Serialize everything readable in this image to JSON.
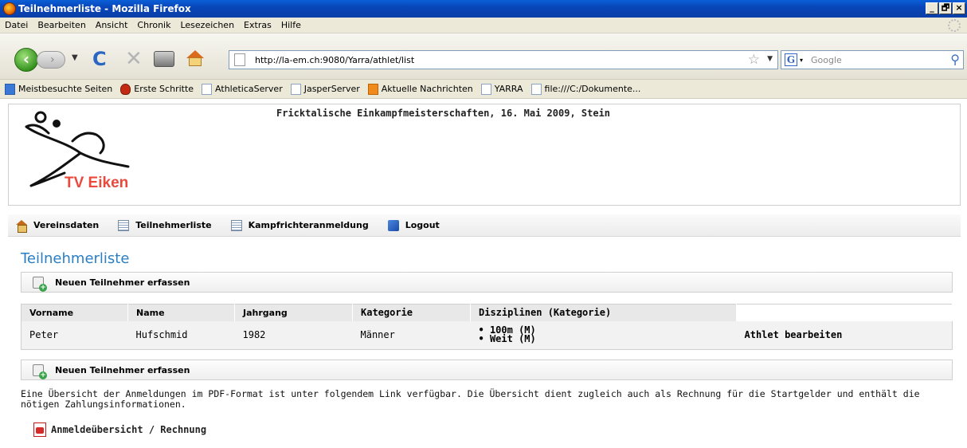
{
  "window": {
    "title": "Teilnehmerliste - Mozilla Firefox",
    "buttons": [
      "_",
      "🗗",
      "×"
    ]
  },
  "menu": {
    "items": [
      "Datei",
      "Bearbeiten",
      "Ansicht",
      "Chronik",
      "Lesezeichen",
      "Extras",
      "Hilfe"
    ]
  },
  "toolbar": {
    "url": "http://la-em.ch:9080/Yarra/athlet/list",
    "search_placeholder": "Google",
    "search_engine_icon": "G"
  },
  "bookmarks": {
    "items": [
      "Meistbesuchte Seiten",
      "Erste Schritte",
      "AthleticaServer",
      "JasperServer",
      "Aktuelle Nachrichten",
      "YARRA",
      "file:///C:/Dokumente..."
    ]
  },
  "header": {
    "logo_text": "TV Eiken",
    "event_title": "Fricktalische Einkampfmeisterschaften, 16. Mai 2009, Stein"
  },
  "app_nav": {
    "items": [
      {
        "label": "Vereinsdaten",
        "icon": "house-icon"
      },
      {
        "label": "Teilnehmerliste",
        "icon": "list-icon"
      },
      {
        "label": "Kampfrichteranmeldung",
        "icon": "list-icon"
      },
      {
        "label": "Logout",
        "icon": "logout-icon"
      }
    ]
  },
  "main": {
    "heading": "Teilnehmerliste",
    "add_label": "Neuen Teilnehmer erfassen",
    "table": {
      "columns": [
        "Vorname",
        "Name",
        "Jahrgang",
        "Kategorie",
        "Disziplinen (Kategorie)",
        ""
      ],
      "rows": [
        {
          "vorname": "Peter",
          "name": "Hufschmid",
          "jahrgang": "1982",
          "kategorie": "Männer",
          "disziplinen": [
            "• 100m (M)",
            "• Weit (M)"
          ],
          "action": "Athlet bearbeiten"
        }
      ]
    },
    "info_text": "Eine Übersicht der Anmeldungen im PDF-Format ist unter folgendem Link verfügbar. Die Übersicht dient zugleich auch als Rechnung für die Startgelder und enthält die nötigen Zahlungsinformationen.",
    "pdf_link": "Anmeldeübersicht / Rechnung"
  }
}
